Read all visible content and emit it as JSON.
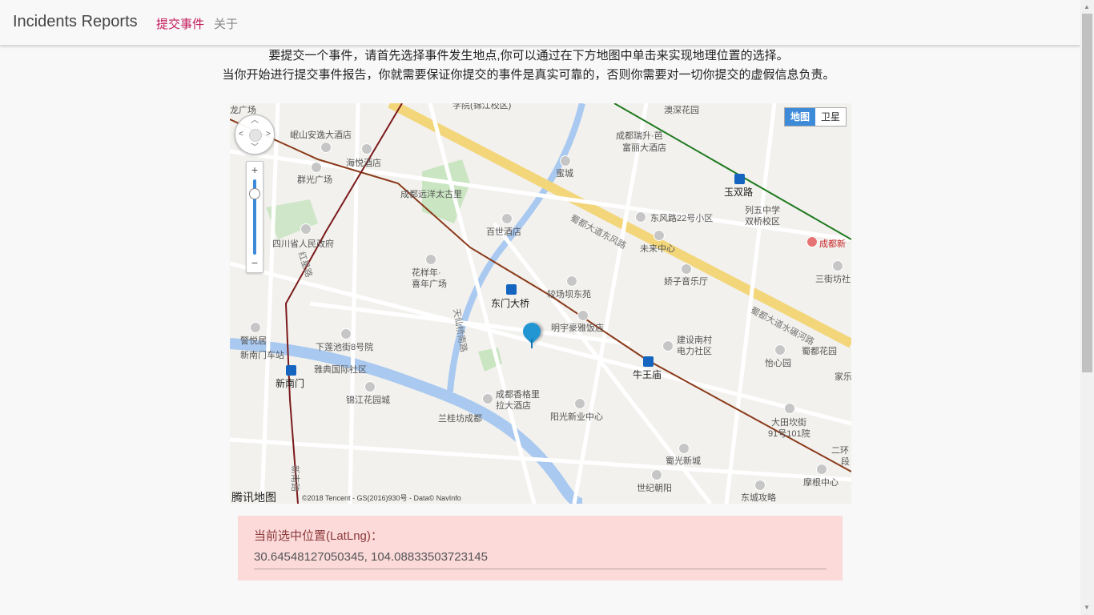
{
  "navbar": {
    "brand": "Incidents Reports",
    "links": [
      {
        "label": "提交事件",
        "active": true
      },
      {
        "label": "关于",
        "active": false
      }
    ],
    "active_color": "#c2185b"
  },
  "intro": {
    "line1": "要提交一个事件，请首先选择事件发生地点,你可以通过在下方地图中单击来实现地理位置的选择。",
    "line2": "当你开始进行提交事件报告，你就需要保证你提交的事件是真实可靠的，否则你需要对一切你提交的虚假信息负责。"
  },
  "map": {
    "type_buttons": {
      "map": "地图",
      "satellite": "卫星"
    },
    "selected_type": "地图",
    "zoom": {
      "in": "+",
      "out": "−"
    },
    "logo_text": "腾讯地图",
    "copyright": "©2018 Tencent - GS(2016)930号 - Data© NavInfo",
    "labels": {
      "l1": "岷山安逸大酒店",
      "l2": "海悦酒店",
      "l3": "群光广场",
      "l4": "成都远洋太古里",
      "l5": "四川省人民政府",
      "l6": "百世酒店",
      "l7": "花样年·",
      "l8": "喜年广场",
      "l9": "东门大桥",
      "l10": "较场坝东苑",
      "l11": "明宇豪雅饭店",
      "l12": "下莲池街8号院",
      "l13": "雅典国际社区",
      "l14": "锦江花园城",
      "l15": "成都香格里",
      "l16": "拉大酒店",
      "l17": "兰桂坊成都",
      "l18": "阳光新业中心",
      "l19": "建设南村",
      "l20": "电力社区",
      "l21": "牛王庙",
      "l22": "怡心园",
      "l23": "蜀都花园",
      "l24": "家乐",
      "l25": "大田坎街",
      "l26": "91号101院",
      "l27": "蜀光新城",
      "l28": "世纪朝阳",
      "l29": "东城攻略",
      "l30": "摩根中心",
      "l31": "二环",
      "l32": "段",
      "l33": "成都瑞升·芭",
      "l34": "富丽大酒店",
      "l35": "蜜城",
      "l36": "东风路22号小区",
      "l37": "未来中心",
      "l38": "娇子音乐厅",
      "l39": "玉双路",
      "l40": "列五中学",
      "l41": "双桥校区",
      "l42": "成都新",
      "l43": "三街坊社",
      "l44": "警悦居",
      "l45": "新南门车站",
      "l46": "新南门",
      "l47": "澳深花园",
      "l48": "蜀都大道东风路",
      "l49": "蜀都大道水碾河路",
      "l50": "红星路",
      "l51": "天仙桥南路",
      "l52": "新南路",
      "l53": "龙广场",
      "l54": "学院(锦江校区)"
    }
  },
  "location": {
    "label": "当前选中位置(LatLng)：",
    "value": "30.64548127050345, 104.08833503723145"
  }
}
